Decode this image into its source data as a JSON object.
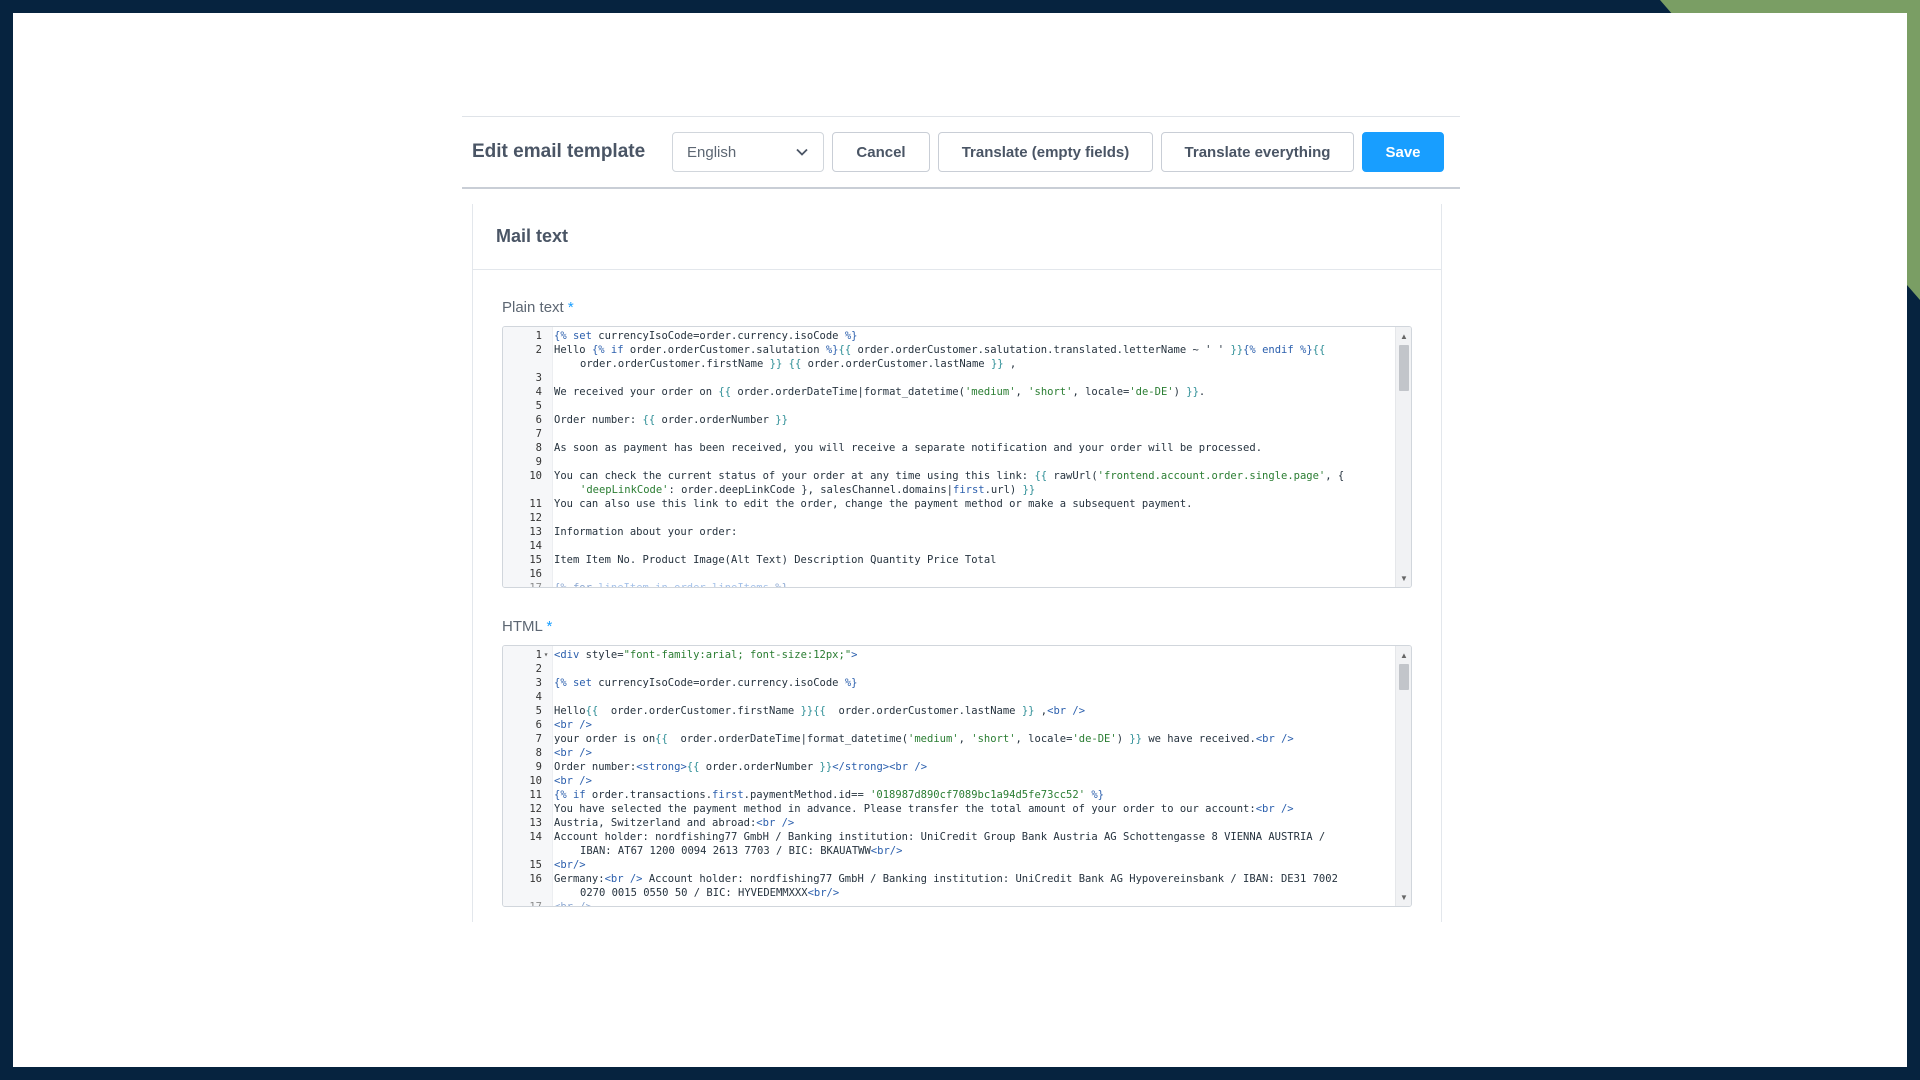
{
  "header": {
    "title": "Edit email template",
    "language": "English",
    "cancel_label": "Cancel",
    "translate_empty_label": "Translate (empty fields)",
    "translate_all_label": "Translate everything",
    "save_label": "Save"
  },
  "card": {
    "title": "Mail text",
    "plain_label": "Plain text",
    "html_label": "HTML",
    "required_mark": "*"
  },
  "plain_lines": [
    {
      "n": "1",
      "parts": [
        [
          "kw",
          "{% set"
        ],
        [
          "",
          " currencyIsoCode=order.currency.isoCode "
        ],
        [
          "kw",
          "%}"
        ]
      ]
    },
    {
      "n": "2",
      "parts": [
        [
          "",
          "Hello "
        ],
        [
          "kw",
          "{% if"
        ],
        [
          "",
          " order.orderCustomer.salutation "
        ],
        [
          "kw",
          "%}"
        ],
        [
          "br",
          "{{"
        ],
        [
          "",
          " order.orderCustomer.salutation.translated.letterName ~ ' ' "
        ],
        [
          "br",
          "}}"
        ],
        [
          "kw",
          "{% endif %}"
        ],
        [
          "br",
          "{{"
        ]
      ]
    },
    {
      "n": "",
      "wrap": true,
      "parts": [
        [
          "",
          "order.orderCustomer.firstName "
        ],
        [
          "br",
          "}}"
        ],
        [
          "",
          " "
        ],
        [
          "br",
          "{{"
        ],
        [
          "",
          " order.orderCustomer.lastName "
        ],
        [
          "br",
          "}}"
        ],
        [
          "",
          " ,"
        ]
      ]
    },
    {
      "n": "3",
      "parts": []
    },
    {
      "n": "4",
      "parts": [
        [
          "",
          "We received your order on "
        ],
        [
          "br",
          "{{"
        ],
        [
          "",
          " order.orderDateTime|format_datetime("
        ],
        [
          "str",
          "'medium'"
        ],
        [
          "",
          ", "
        ],
        [
          "str",
          "'short'"
        ],
        [
          "",
          ", locale="
        ],
        [
          "str",
          "'de-DE'"
        ],
        [
          "",
          ") "
        ],
        [
          "br",
          "}}"
        ],
        [
          "",
          "."
        ]
      ]
    },
    {
      "n": "5",
      "parts": []
    },
    {
      "n": "6",
      "parts": [
        [
          "",
          "Order number: "
        ],
        [
          "br",
          "{{"
        ],
        [
          "",
          " order.orderNumber "
        ],
        [
          "br",
          "}}"
        ]
      ]
    },
    {
      "n": "7",
      "parts": []
    },
    {
      "n": "8",
      "parts": [
        [
          "",
          "As soon as payment has been received, you will receive a separate notification and your order will be processed."
        ]
      ]
    },
    {
      "n": "9",
      "parts": []
    },
    {
      "n": "10",
      "parts": [
        [
          "",
          "You can check the current status of your order at any time using this link: "
        ],
        [
          "br",
          "{{"
        ],
        [
          "",
          " rawUrl("
        ],
        [
          "str",
          "'frontend.account.order.single.page'"
        ],
        [
          "",
          ", {"
        ]
      ]
    },
    {
      "n": "",
      "wrap": true,
      "parts": [
        [
          "str",
          "'deepLinkCode'"
        ],
        [
          "",
          ": order.deepLinkCode }, salesChannel.domains|"
        ],
        [
          "kw",
          "first"
        ],
        [
          "",
          ".url) "
        ],
        [
          "br",
          "}}"
        ]
      ]
    },
    {
      "n": "11",
      "parts": [
        [
          "",
          "You can also use this link to edit the order, change the payment method or make a subsequent payment."
        ]
      ]
    },
    {
      "n": "12",
      "parts": []
    },
    {
      "n": "13",
      "parts": [
        [
          "",
          "Information about your order:"
        ]
      ]
    },
    {
      "n": "14",
      "parts": []
    },
    {
      "n": "15",
      "parts": [
        [
          "",
          "Item Item No. Product Image(Alt Text) Description Quantity Price Total"
        ]
      ]
    },
    {
      "n": "16",
      "parts": []
    },
    {
      "n": "17",
      "cut": true,
      "parts": [
        [
          "kw",
          "{% for"
        ],
        [
          "",
          " lineItem in order.lineItems "
        ],
        [
          "kw",
          "%}"
        ]
      ]
    }
  ],
  "html_lines": [
    {
      "n": "1",
      "fold": true,
      "parts": [
        [
          "kw",
          "<div"
        ],
        [
          "",
          " style="
        ],
        [
          "str",
          "\"font-family:arial; font-size:12px;\""
        ],
        [
          "kw",
          ">"
        ]
      ]
    },
    {
      "n": "2",
      "parts": []
    },
    {
      "n": "3",
      "parts": [
        [
          "kw",
          "{% set"
        ],
        [
          "",
          " currencyIsoCode=order.currency.isoCode "
        ],
        [
          "kw",
          "%}"
        ]
      ]
    },
    {
      "n": "4",
      "parts": []
    },
    {
      "n": "5",
      "parts": [
        [
          "",
          "Hello"
        ],
        [
          "br",
          "{{"
        ],
        [
          "",
          "  order.orderCustomer.firstName "
        ],
        [
          "br",
          "}}{{"
        ],
        [
          "",
          "  order.orderCustomer.lastName "
        ],
        [
          "br",
          "}}"
        ],
        [
          "",
          " ,"
        ],
        [
          "kw",
          "<br />"
        ]
      ]
    },
    {
      "n": "6",
      "parts": [
        [
          "kw",
          "<br />"
        ]
      ]
    },
    {
      "n": "7",
      "parts": [
        [
          "",
          "your order is on"
        ],
        [
          "br",
          "{{"
        ],
        [
          "",
          "  order.orderDateTime|format_datetime("
        ],
        [
          "str",
          "'medium'"
        ],
        [
          "",
          ", "
        ],
        [
          "str",
          "'short'"
        ],
        [
          "",
          ", locale="
        ],
        [
          "str",
          "'de-DE'"
        ],
        [
          "",
          ") "
        ],
        [
          "br",
          "}}"
        ],
        [
          "",
          " we have received."
        ],
        [
          "kw",
          "<br />"
        ]
      ]
    },
    {
      "n": "8",
      "parts": [
        [
          "kw",
          "<br />"
        ]
      ]
    },
    {
      "n": "9",
      "parts": [
        [
          "",
          "Order number:"
        ],
        [
          "kw",
          "<strong>"
        ],
        [
          "br",
          "{{"
        ],
        [
          "",
          " order.orderNumber "
        ],
        [
          "br",
          "}}"
        ],
        [
          "kw",
          "</strong><br />"
        ]
      ]
    },
    {
      "n": "10",
      "parts": [
        [
          "kw",
          "<br />"
        ]
      ]
    },
    {
      "n": "11",
      "parts": [
        [
          "kw",
          "{% if"
        ],
        [
          "",
          " order.transactions."
        ],
        [
          "kw",
          "first"
        ],
        [
          "",
          ".paymentMethod.id== "
        ],
        [
          "str",
          "'018987d890cf7089bc1a94d5fe73cc52'"
        ],
        [
          "",
          " "
        ],
        [
          "kw",
          "%}"
        ]
      ]
    },
    {
      "n": "12",
      "parts": [
        [
          "",
          "You have selected the payment method in advance. Please transfer the total amount of your order to our account:"
        ],
        [
          "kw",
          "<br />"
        ]
      ]
    },
    {
      "n": "13",
      "parts": [
        [
          "",
          "Austria, Switzerland and abroad:"
        ],
        [
          "kw",
          "<br />"
        ]
      ]
    },
    {
      "n": "14",
      "parts": [
        [
          "",
          "Account holder: nordfishing77 GmbH / Banking institution: UniCredit Group Bank Austria AG Schottengasse 8 VIENNA AUSTRIA /"
        ]
      ]
    },
    {
      "n": "",
      "wrap": true,
      "parts": [
        [
          "",
          "IBAN: AT67 1200 0094 2613 7703 / BIC: BKAUATWW"
        ],
        [
          "kw",
          "<br/>"
        ]
      ]
    },
    {
      "n": "15",
      "parts": [
        [
          "kw",
          "<br/>"
        ]
      ]
    },
    {
      "n": "16",
      "parts": [
        [
          "",
          "Germany:"
        ],
        [
          "kw",
          "<br />"
        ],
        [
          "",
          " Account holder: nordfishing77 GmbH / Banking institution: UniCredit Bank AG Hypovereinsbank / IBAN: DE31 7002"
        ]
      ]
    },
    {
      "n": "",
      "wrap": true,
      "parts": [
        [
          "",
          "0270 0015 0550 50 / BIC: HYVEDEMMXXX"
        ],
        [
          "kw",
          "<br/>"
        ]
      ]
    },
    {
      "n": "17",
      "cut": true,
      "parts": [
        [
          "kw",
          "<br />"
        ]
      ]
    }
  ],
  "icons": {
    "chevron": "chevron-down-icon",
    "scroll_up": "arrow-up-icon",
    "scroll_down": "arrow-down-icon",
    "fold": "fold-caret-icon"
  },
  "colors": {
    "accent": "#189eff",
    "frame": "#06233f",
    "corner": "#7a9e64"
  },
  "scroll": {
    "plain_position": 0,
    "html_position": 0
  }
}
